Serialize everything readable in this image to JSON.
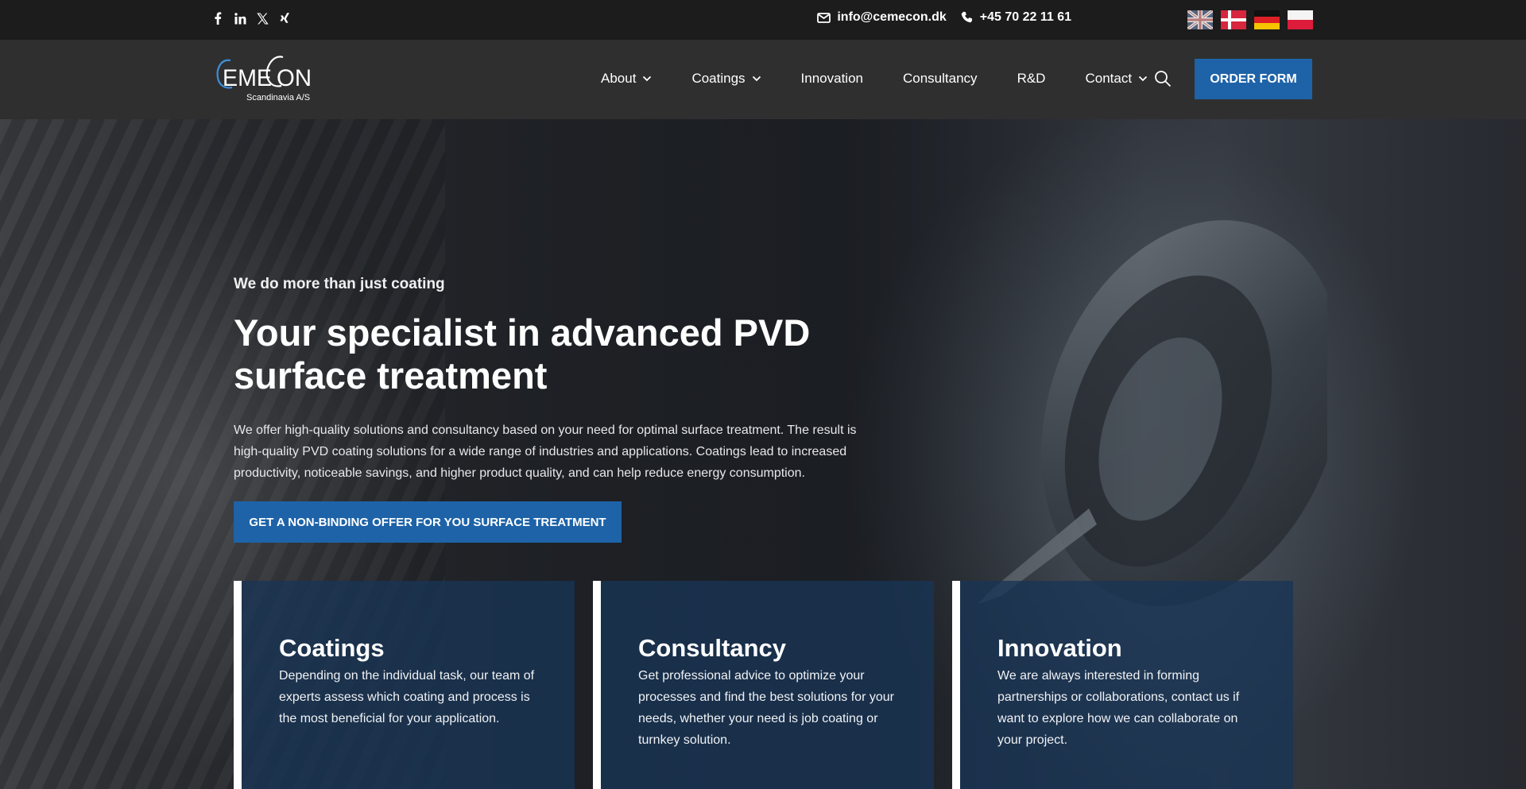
{
  "topbar": {
    "social": [
      {
        "name": "facebook-icon",
        "glyph": "f"
      },
      {
        "name": "linkedin-icon",
        "glyph": "in"
      },
      {
        "name": "x-icon",
        "glyph": "X"
      },
      {
        "name": "xing-icon",
        "glyph": "x"
      }
    ],
    "email": "info@cemecon.dk",
    "phone": "+45 70 22 11 61",
    "flags": [
      "english-flag-icon",
      "danish-flag-icon",
      "german-flag-icon",
      "polish-flag-icon"
    ]
  },
  "header": {
    "logo_name": "CemeCon",
    "logo_sub": "Scandinavia A/S",
    "nav": [
      {
        "label": "About",
        "has_dropdown": true
      },
      {
        "label": "Coatings",
        "has_dropdown": true
      },
      {
        "label": "Innovation",
        "has_dropdown": false
      },
      {
        "label": "Consultancy",
        "has_dropdown": false
      },
      {
        "label": "R&D",
        "has_dropdown": false
      },
      {
        "label": "Contact",
        "has_dropdown": true
      }
    ],
    "order_label": "ORDER FORM"
  },
  "hero": {
    "kicker": "We do more than just coating",
    "headline": "Your specialist in advanced PVD surface treatment",
    "lead": "We offer high-quality solutions and consultancy based on your need for optimal surface treatment. The result is high-quality PVD coating solutions for a wide range of industries and applications. Coatings lead to increased productivity, noticeable savings, and higher product quality,  and can help reduce energy consumption.",
    "cta": "GET A NON-BINDING OFFER FOR YOU SURFACE TREATMENT"
  },
  "cards": [
    {
      "title": "Coatings",
      "text": "Depending on the individual task, our team of experts assess which coating and process is the most beneficial for your application."
    },
    {
      "title": "Consultancy",
      "text": "Get professional advice to optimize your processes and find the best solutions for your needs, whether your need is job coating or turnkey solution."
    },
    {
      "title": "Innovation",
      "text": "We are always interested in forming partnerships or collaborations, contact us if want to explore how we can collaborate on your project."
    }
  ],
  "colors": {
    "accent": "#1e63a8",
    "topbar": "#1c1c1c",
    "header": "#2f2f30",
    "card": "#183456"
  }
}
